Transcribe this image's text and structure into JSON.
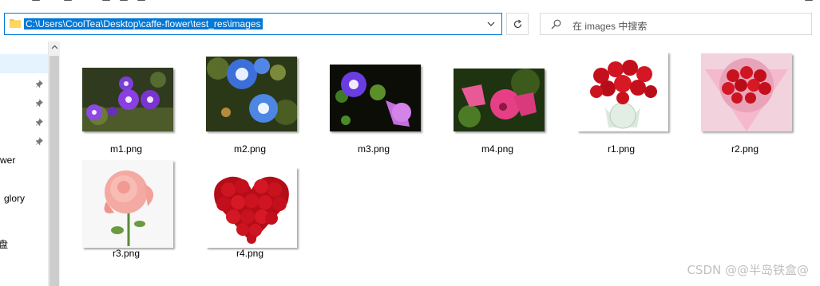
{
  "address": {
    "path": "C:\\Users\\CoolTea\\Desktop\\caffe-flower\\test_res\\images"
  },
  "search": {
    "placeholder": "在 images 中搜索"
  },
  "nav": {
    "items": [
      {
        "label": "wer"
      },
      {
        "label": "glory"
      },
      {
        "label": "盘"
      }
    ]
  },
  "files": [
    {
      "name": "m1.png",
      "thumb": "morning-glory-purple"
    },
    {
      "name": "m2.png",
      "thumb": "morning-glory-blue"
    },
    {
      "name": "m3.png",
      "thumb": "morning-glory-violet"
    },
    {
      "name": "m4.png",
      "thumb": "morning-glory-pink"
    },
    {
      "name": "r1.png",
      "thumb": "red-roses-vase"
    },
    {
      "name": "r2.png",
      "thumb": "red-roses-bouquet"
    },
    {
      "name": "r3.png",
      "thumb": "pink-rose"
    },
    {
      "name": "r4.png",
      "thumb": "rose-heart"
    }
  ],
  "watermark": "CSDN @@半岛铁盒@",
  "colors": {
    "selection": "#0078d7",
    "nav_highlight": "#e5f3ff"
  }
}
